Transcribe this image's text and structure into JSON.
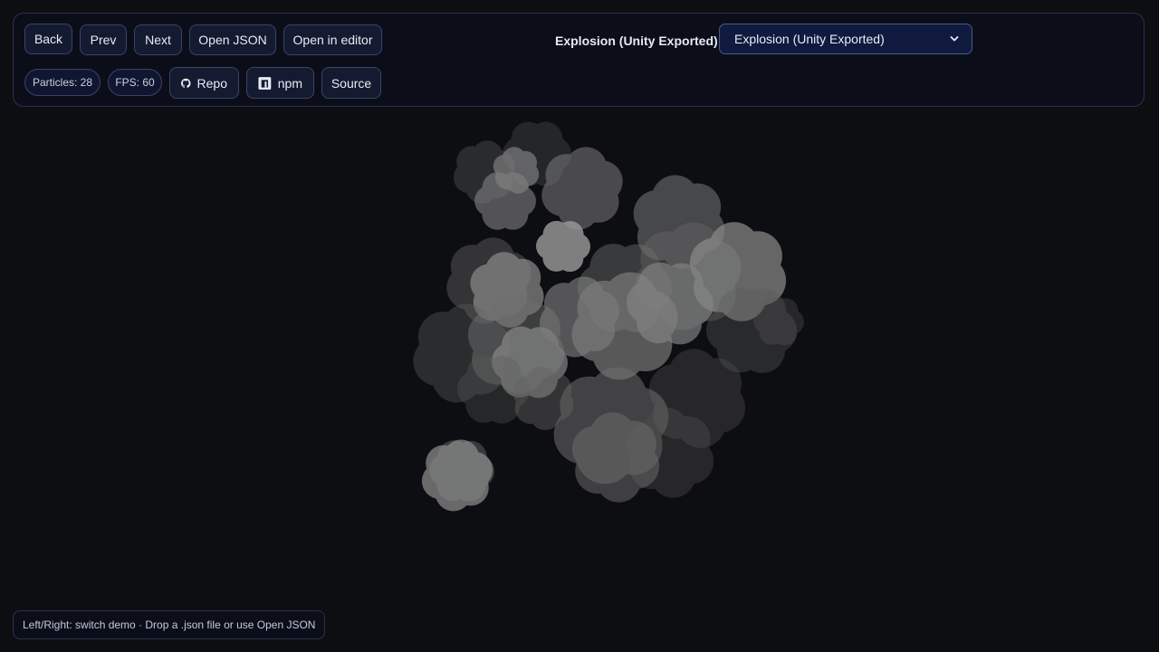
{
  "toolbar": {
    "back_label": "Back",
    "prev_label": "Prev",
    "next_label": "Next",
    "open_json_label": "Open JSON",
    "open_editor_label": "Open in editor",
    "demo_label": "Explosion (Unity Exported)",
    "demo_select_value": "Explosion (Unity Exported)"
  },
  "stats": {
    "particles": "Particles: 28",
    "fps": "FPS: 60"
  },
  "links": {
    "repo_label": "Repo",
    "npm_label": "npm",
    "source_label": "Source"
  },
  "footer": {
    "hint": "Left/Right: switch demo · Drop a .json file or use Open JSON"
  },
  "icons": {
    "repo": "github-icon",
    "npm": "npm-icon",
    "select": "chevron-down-icon"
  },
  "colors": {
    "background": "#0d0e12",
    "panel": "#0b0e19",
    "button": "#141a30",
    "border": "#3a4468",
    "smoke": "#8c8c8c"
  }
}
